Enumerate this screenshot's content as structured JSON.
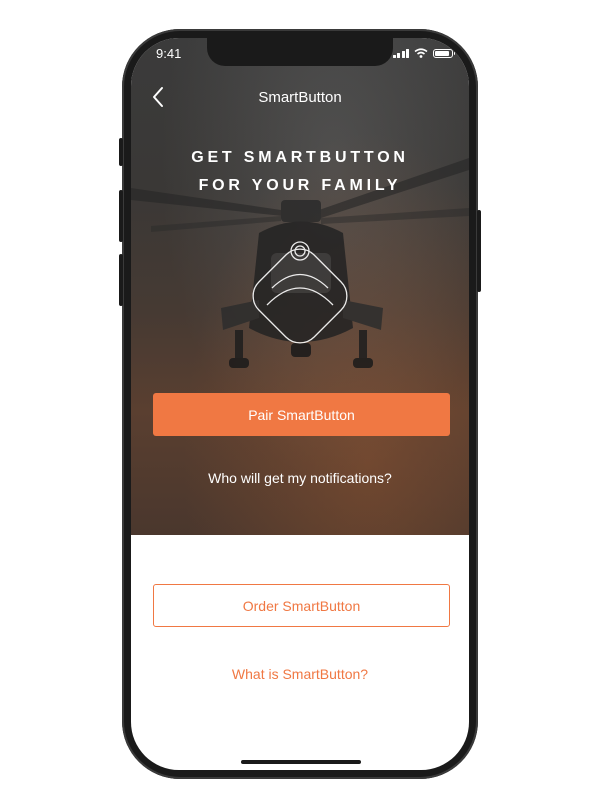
{
  "status_bar": {
    "time": "9:41"
  },
  "nav": {
    "title": "SmartButton"
  },
  "hero": {
    "headline_line1": "GET SMARTBUTTON",
    "headline_line2": "FOR YOUR FAMILY"
  },
  "actions": {
    "pair_label": "Pair SmartButton",
    "who_label": "Who will get my notifications?",
    "order_label": "Order SmartButton",
    "what_label": "What is SmartButton?"
  },
  "colors": {
    "accent": "#f07843",
    "hero_bg": "#3b3b3b"
  },
  "icons": [
    "chevron-left-icon",
    "signal-icon",
    "wifi-icon",
    "battery-icon",
    "smartbutton-icon"
  ]
}
